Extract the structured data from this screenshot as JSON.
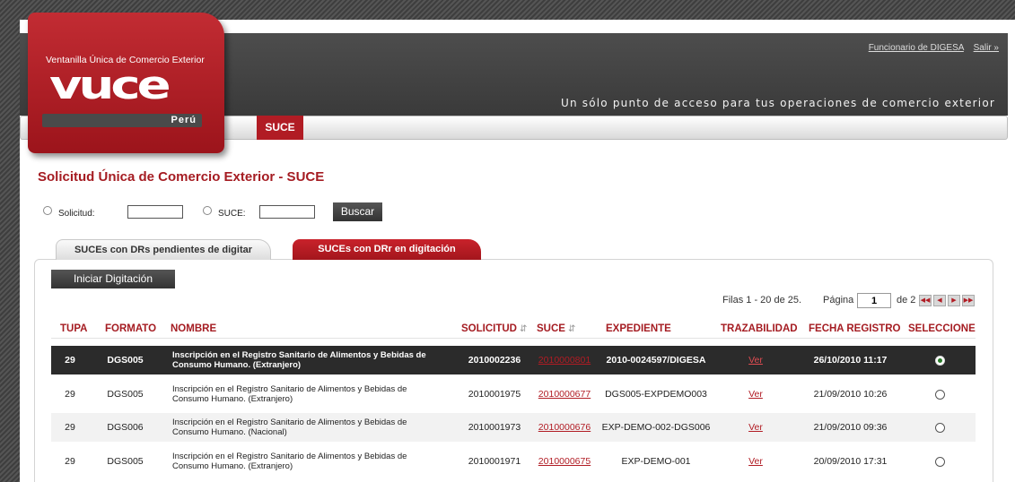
{
  "header": {
    "user_link": "Funcionario de DIGESA",
    "logout_link": "Salir »",
    "slogan": "Un sólo punto de acceso para tus operaciones de comercio exterior",
    "nav_tab": "SUCE"
  },
  "logo": {
    "top_text": "Ventanilla Única de Comercio Exterior",
    "word": "vuce",
    "country": "Perú"
  },
  "page": {
    "title": "Solicitud Única de Comercio Exterior - SUCE"
  },
  "search": {
    "label_solicitud": "Solicitud:",
    "value_solicitud": "",
    "label_suce": "SUCE:",
    "value_suce": "",
    "button": "Buscar"
  },
  "tabs": [
    {
      "label": "SUCEs con DRs pendientes de digitar",
      "active": true
    },
    {
      "label": "SUCEs con DRr en digitación",
      "active": false
    }
  ],
  "actions": {
    "iniciar": "Iniciar Digitación"
  },
  "pager": {
    "rows_text": "Filas 1 - 20 de 25.",
    "page_label": "Página",
    "page_value": "1",
    "of_text": "de 2",
    "icons": [
      "first-page-icon",
      "prev-page-icon",
      "next-page-icon",
      "last-page-icon"
    ]
  },
  "table": {
    "columns": [
      "TUPA",
      "FORMATO",
      "NOMBRE",
      "SOLICITUD",
      "SUCE",
      "EXPEDIENTE",
      "TRAZABILIDAD",
      "FECHA REGISTRO",
      "SELECCIONE"
    ],
    "rows": [
      {
        "tupa": "29",
        "formato": "DGS005",
        "nombre": "Inscripción en el Registro Sanitario de Alimentos y Bebidas de Consumo Humano. (Extranjero)",
        "solicitud": "2010002236",
        "suce": "2010000801",
        "expediente": "2010-0024597/DIGESA",
        "trazabilidad": "Ver",
        "fecha": "26/10/2010 11:17",
        "selected": true
      },
      {
        "tupa": "29",
        "formato": "DGS005",
        "nombre": "Inscripción en el Registro Sanitario de Alimentos y Bebidas de Consumo Humano. (Extranjero)",
        "solicitud": "2010001975",
        "suce": "2010000677",
        "expediente": "DGS005-EXPDEMO003",
        "trazabilidad": "Ver",
        "fecha": "21/09/2010 10:26",
        "selected": false
      },
      {
        "tupa": "29",
        "formato": "DGS006",
        "nombre": "Inscripción en el Registro Sanitario de Alimentos y Bebidas de Consumo Humano. (Nacional)",
        "solicitud": "2010001973",
        "suce": "2010000676",
        "expediente": "EXP-DEMO-002-DGS006",
        "trazabilidad": "Ver",
        "fecha": "21/09/2010 09:36",
        "selected": false
      },
      {
        "tupa": "29",
        "formato": "DGS005",
        "nombre": "Inscripción en el Registro Sanitario de Alimentos y Bebidas de Consumo Humano. (Extranjero)",
        "solicitud": "2010001971",
        "suce": "2010000675",
        "expediente": "EXP-DEMO-001",
        "trazabilidad": "Ver",
        "fecha": "20/09/2010 17:31",
        "selected": false
      }
    ]
  },
  "colors": {
    "brand_red": "#b11c24",
    "header_dark": "#444444",
    "selected_row": "#2b2b2b"
  }
}
